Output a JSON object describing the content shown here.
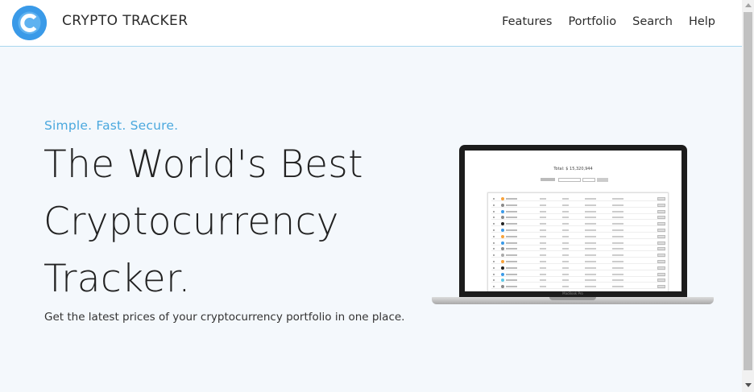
{
  "nav": {
    "brand": "CRYPTO TRACKER",
    "logo_icon": "letter-c-logo-icon",
    "links": [
      "Features",
      "Portfolio",
      "Search",
      "Help"
    ]
  },
  "hero": {
    "tagline": "Simple. Fast. Secure.",
    "headline": "The World's Best Cryptocurrency Tracker.",
    "subtext": "Get the latest prices of your cryptocurrency portfolio in one place."
  },
  "mockup": {
    "total_text": "Total: $ 15,320,944",
    "device_label": "MacBook Pro"
  },
  "colors": {
    "accent": "#4aa8de",
    "logo": "#3a9ae8",
    "background": "#f4f8fc"
  }
}
